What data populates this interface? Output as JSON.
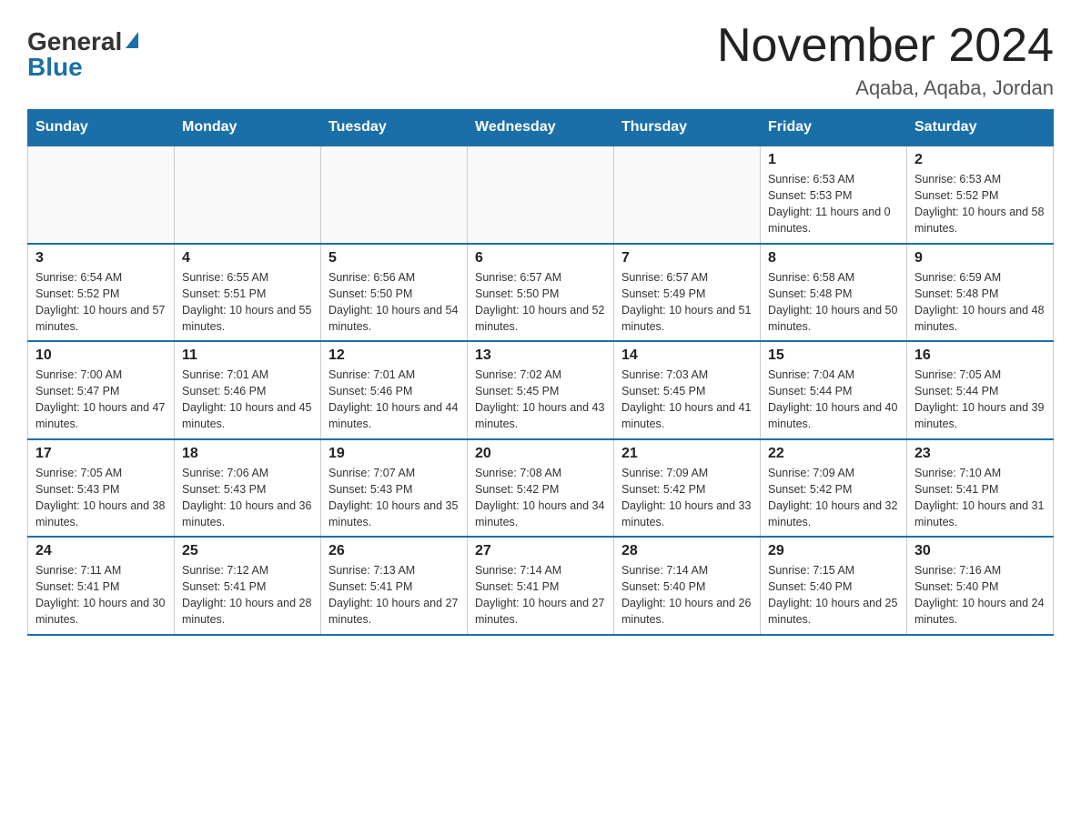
{
  "header": {
    "logo_general": "General",
    "logo_blue": "Blue",
    "month_title": "November 2024",
    "location": "Aqaba, Aqaba, Jordan"
  },
  "weekdays": [
    "Sunday",
    "Monday",
    "Tuesday",
    "Wednesday",
    "Thursday",
    "Friday",
    "Saturday"
  ],
  "weeks": [
    [
      {
        "day": "",
        "sunrise": "",
        "sunset": "",
        "daylight": ""
      },
      {
        "day": "",
        "sunrise": "",
        "sunset": "",
        "daylight": ""
      },
      {
        "day": "",
        "sunrise": "",
        "sunset": "",
        "daylight": ""
      },
      {
        "day": "",
        "sunrise": "",
        "sunset": "",
        "daylight": ""
      },
      {
        "day": "",
        "sunrise": "",
        "sunset": "",
        "daylight": ""
      },
      {
        "day": "1",
        "sunrise": "Sunrise: 6:53 AM",
        "sunset": "Sunset: 5:53 PM",
        "daylight": "Daylight: 11 hours and 0 minutes."
      },
      {
        "day": "2",
        "sunrise": "Sunrise: 6:53 AM",
        "sunset": "Sunset: 5:52 PM",
        "daylight": "Daylight: 10 hours and 58 minutes."
      }
    ],
    [
      {
        "day": "3",
        "sunrise": "Sunrise: 6:54 AM",
        "sunset": "Sunset: 5:52 PM",
        "daylight": "Daylight: 10 hours and 57 minutes."
      },
      {
        "day": "4",
        "sunrise": "Sunrise: 6:55 AM",
        "sunset": "Sunset: 5:51 PM",
        "daylight": "Daylight: 10 hours and 55 minutes."
      },
      {
        "day": "5",
        "sunrise": "Sunrise: 6:56 AM",
        "sunset": "Sunset: 5:50 PM",
        "daylight": "Daylight: 10 hours and 54 minutes."
      },
      {
        "day": "6",
        "sunrise": "Sunrise: 6:57 AM",
        "sunset": "Sunset: 5:50 PM",
        "daylight": "Daylight: 10 hours and 52 minutes."
      },
      {
        "day": "7",
        "sunrise": "Sunrise: 6:57 AM",
        "sunset": "Sunset: 5:49 PM",
        "daylight": "Daylight: 10 hours and 51 minutes."
      },
      {
        "day": "8",
        "sunrise": "Sunrise: 6:58 AM",
        "sunset": "Sunset: 5:48 PM",
        "daylight": "Daylight: 10 hours and 50 minutes."
      },
      {
        "day": "9",
        "sunrise": "Sunrise: 6:59 AM",
        "sunset": "Sunset: 5:48 PM",
        "daylight": "Daylight: 10 hours and 48 minutes."
      }
    ],
    [
      {
        "day": "10",
        "sunrise": "Sunrise: 7:00 AM",
        "sunset": "Sunset: 5:47 PM",
        "daylight": "Daylight: 10 hours and 47 minutes."
      },
      {
        "day": "11",
        "sunrise": "Sunrise: 7:01 AM",
        "sunset": "Sunset: 5:46 PM",
        "daylight": "Daylight: 10 hours and 45 minutes."
      },
      {
        "day": "12",
        "sunrise": "Sunrise: 7:01 AM",
        "sunset": "Sunset: 5:46 PM",
        "daylight": "Daylight: 10 hours and 44 minutes."
      },
      {
        "day": "13",
        "sunrise": "Sunrise: 7:02 AM",
        "sunset": "Sunset: 5:45 PM",
        "daylight": "Daylight: 10 hours and 43 minutes."
      },
      {
        "day": "14",
        "sunrise": "Sunrise: 7:03 AM",
        "sunset": "Sunset: 5:45 PM",
        "daylight": "Daylight: 10 hours and 41 minutes."
      },
      {
        "day": "15",
        "sunrise": "Sunrise: 7:04 AM",
        "sunset": "Sunset: 5:44 PM",
        "daylight": "Daylight: 10 hours and 40 minutes."
      },
      {
        "day": "16",
        "sunrise": "Sunrise: 7:05 AM",
        "sunset": "Sunset: 5:44 PM",
        "daylight": "Daylight: 10 hours and 39 minutes."
      }
    ],
    [
      {
        "day": "17",
        "sunrise": "Sunrise: 7:05 AM",
        "sunset": "Sunset: 5:43 PM",
        "daylight": "Daylight: 10 hours and 38 minutes."
      },
      {
        "day": "18",
        "sunrise": "Sunrise: 7:06 AM",
        "sunset": "Sunset: 5:43 PM",
        "daylight": "Daylight: 10 hours and 36 minutes."
      },
      {
        "day": "19",
        "sunrise": "Sunrise: 7:07 AM",
        "sunset": "Sunset: 5:43 PM",
        "daylight": "Daylight: 10 hours and 35 minutes."
      },
      {
        "day": "20",
        "sunrise": "Sunrise: 7:08 AM",
        "sunset": "Sunset: 5:42 PM",
        "daylight": "Daylight: 10 hours and 34 minutes."
      },
      {
        "day": "21",
        "sunrise": "Sunrise: 7:09 AM",
        "sunset": "Sunset: 5:42 PM",
        "daylight": "Daylight: 10 hours and 33 minutes."
      },
      {
        "day": "22",
        "sunrise": "Sunrise: 7:09 AM",
        "sunset": "Sunset: 5:42 PM",
        "daylight": "Daylight: 10 hours and 32 minutes."
      },
      {
        "day": "23",
        "sunrise": "Sunrise: 7:10 AM",
        "sunset": "Sunset: 5:41 PM",
        "daylight": "Daylight: 10 hours and 31 minutes."
      }
    ],
    [
      {
        "day": "24",
        "sunrise": "Sunrise: 7:11 AM",
        "sunset": "Sunset: 5:41 PM",
        "daylight": "Daylight: 10 hours and 30 minutes."
      },
      {
        "day": "25",
        "sunrise": "Sunrise: 7:12 AM",
        "sunset": "Sunset: 5:41 PM",
        "daylight": "Daylight: 10 hours and 28 minutes."
      },
      {
        "day": "26",
        "sunrise": "Sunrise: 7:13 AM",
        "sunset": "Sunset: 5:41 PM",
        "daylight": "Daylight: 10 hours and 27 minutes."
      },
      {
        "day": "27",
        "sunrise": "Sunrise: 7:14 AM",
        "sunset": "Sunset: 5:41 PM",
        "daylight": "Daylight: 10 hours and 27 minutes."
      },
      {
        "day": "28",
        "sunrise": "Sunrise: 7:14 AM",
        "sunset": "Sunset: 5:40 PM",
        "daylight": "Daylight: 10 hours and 26 minutes."
      },
      {
        "day": "29",
        "sunrise": "Sunrise: 7:15 AM",
        "sunset": "Sunset: 5:40 PM",
        "daylight": "Daylight: 10 hours and 25 minutes."
      },
      {
        "day": "30",
        "sunrise": "Sunrise: 7:16 AM",
        "sunset": "Sunset: 5:40 PM",
        "daylight": "Daylight: 10 hours and 24 minutes."
      }
    ]
  ]
}
